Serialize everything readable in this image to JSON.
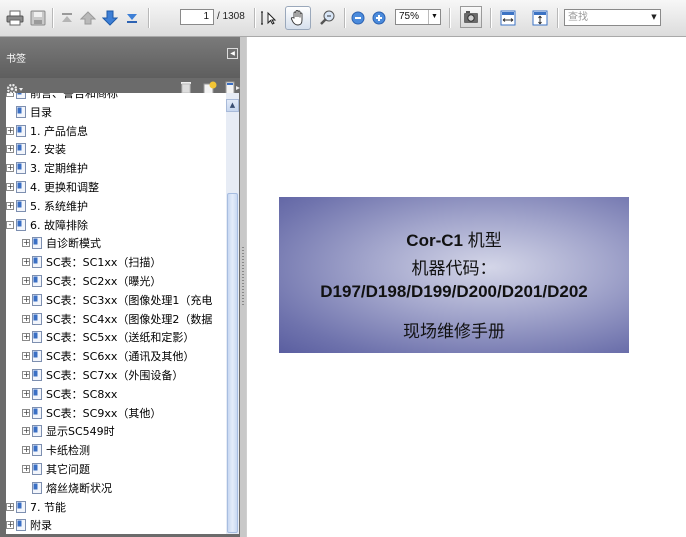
{
  "toolbar": {
    "page_current": "1",
    "page_total": "/ 1308",
    "zoom": "75%",
    "find_placeholder": "查找"
  },
  "panel": {
    "title": "书签",
    "bookmarks": [
      {
        "label": "前言、警告和商标",
        "expander": "-",
        "level": 0
      },
      {
        "label": "目录",
        "expander": "",
        "level": 0
      },
      {
        "label": "1. 产品信息",
        "expander": "+",
        "level": 0
      },
      {
        "label": "2. 安装",
        "expander": "+",
        "level": 0
      },
      {
        "label": "3. 定期维护",
        "expander": "+",
        "level": 0
      },
      {
        "label": "4. 更换和调整",
        "expander": "+",
        "level": 0
      },
      {
        "label": "5. 系统维护",
        "expander": "+",
        "level": 0
      },
      {
        "label": "6. 故障排除",
        "expander": "-",
        "level": 0
      },
      {
        "label": "自诊断模式",
        "expander": "+",
        "level": 1
      },
      {
        "label": "SC表：SC1xx（扫描）",
        "expander": "+",
        "level": 1
      },
      {
        "label": "SC表：SC2xx（曝光）",
        "expander": "+",
        "level": 1
      },
      {
        "label": "SC表：SC3xx（图像处理1（充电",
        "expander": "+",
        "level": 1
      },
      {
        "label": "SC表：SC4xx（图像处理2（数据",
        "expander": "+",
        "level": 1
      },
      {
        "label": "SC表：SC5xx（送纸和定影）",
        "expander": "+",
        "level": 1
      },
      {
        "label": "SC表：SC6xx（通讯及其他）",
        "expander": "+",
        "level": 1
      },
      {
        "label": "SC表：SC7xx（外围设备）",
        "expander": "+",
        "level": 1
      },
      {
        "label": "SC表：SC8xx",
        "expander": "+",
        "level": 1
      },
      {
        "label": "SC表：SC9xx（其他）",
        "expander": "+",
        "level": 1
      },
      {
        "label": "显示SC549时",
        "expander": "+",
        "level": 1
      },
      {
        "label": "卡纸检测",
        "expander": "+",
        "level": 1
      },
      {
        "label": "其它问题",
        "expander": "+",
        "level": 1
      },
      {
        "label": "熔丝烧断状况",
        "expander": "",
        "level": 1
      },
      {
        "label": "7. 节能",
        "expander": "+",
        "level": 0
      },
      {
        "label": "附录",
        "expander": "+",
        "level": 0
      }
    ]
  },
  "document": {
    "line1_model": "Cor-C1",
    "line1_suffix": " 机型",
    "line2": "机器代码：",
    "line3": "D197/D198/D199/D200/D201/D202",
    "line4": "现场维修手册"
  },
  "colors": {
    "cover_dark": "#5a5ea0",
    "cover_light": "#d4d6e8",
    "panel_bg": "#6b6b6b",
    "bookmark_icon": "#3a6fc4"
  }
}
